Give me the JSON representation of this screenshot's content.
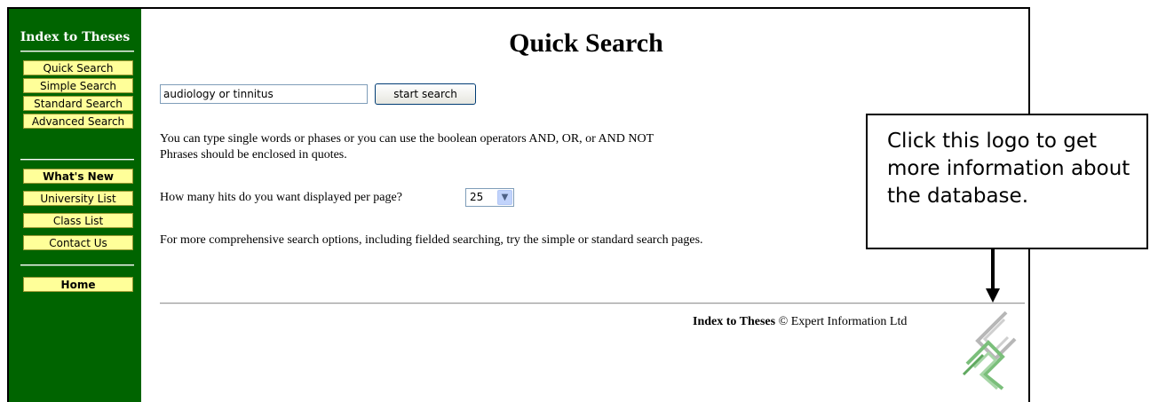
{
  "sidebar": {
    "title": "Index to Theses",
    "search_items": [
      {
        "label": "Quick Search"
      },
      {
        "label": "Simple Search"
      },
      {
        "label": "Standard Search"
      },
      {
        "label": "Advanced Search"
      }
    ],
    "info_items": [
      {
        "label": "What's New"
      },
      {
        "label": "University List"
      },
      {
        "label": "Class List"
      },
      {
        "label": "Contact Us"
      }
    ],
    "home_label": "Home",
    "background": "#006400",
    "button_color": "#ffff99"
  },
  "main": {
    "title": "Quick Search",
    "search": {
      "value": "audiology or tinnitus",
      "button_label": "start search"
    },
    "help_line1": "You can type single words or phases or you can use the boolean operators AND, OR, or AND NOT",
    "help_line2": "Phrases should be enclosed in quotes.",
    "hits_question": "How many hits do you want displayed per page?",
    "hits_value": "25",
    "more_options": "For more comprehensive search options, including fielded searching, try the simple or standard search pages."
  },
  "footer": {
    "brand": "Index to Theses",
    "copyright": "© Expert Information Ltd",
    "logo_icon": "expert-information-logo-icon"
  },
  "callout": {
    "text": "Click this logo to get more information about the database."
  }
}
